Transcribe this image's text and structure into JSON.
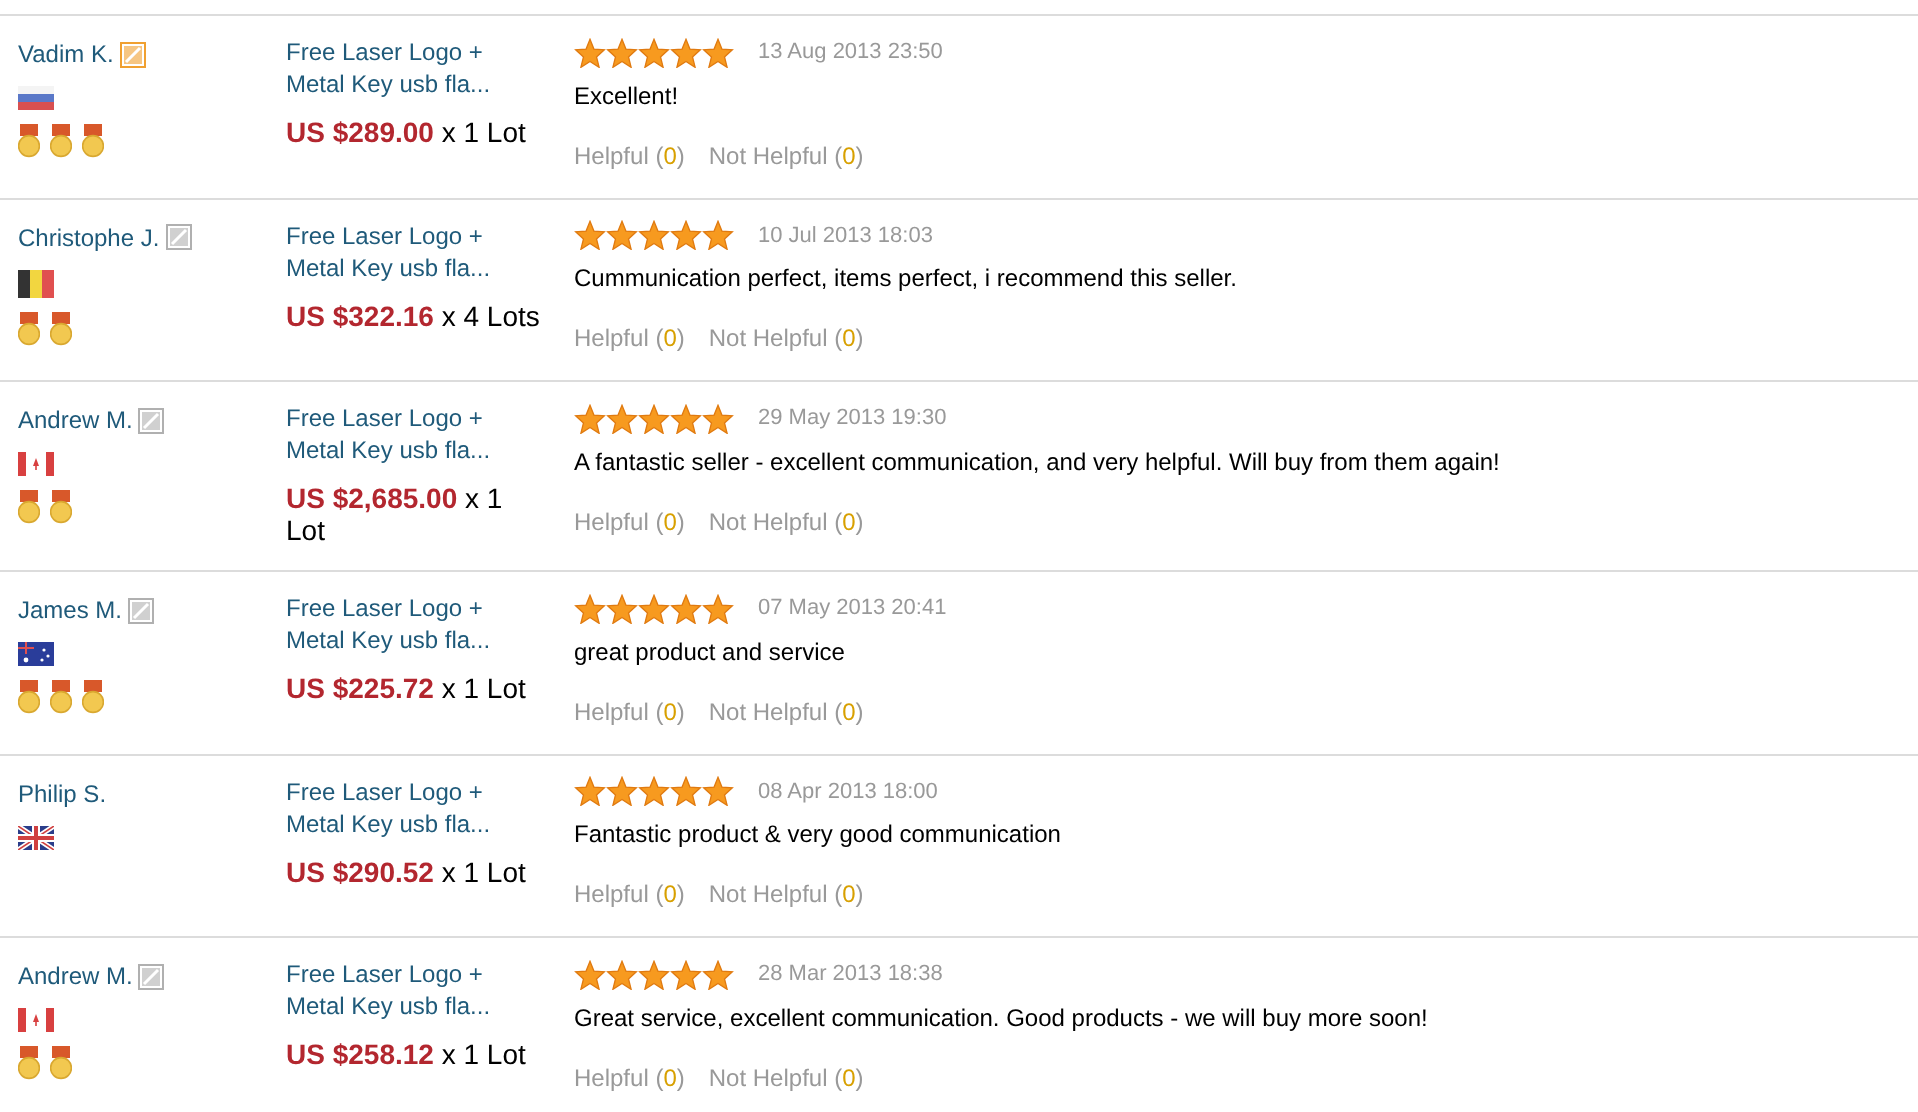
{
  "reviews": [
    {
      "name": "Vadim K.",
      "badge": {
        "color": "#f0a030"
      },
      "flag": {
        "kind": "ru"
      },
      "medals": [
        {
          "kind": "medal"
        },
        {
          "kind": "medal"
        },
        {
          "kind": "medal"
        }
      ],
      "product": "Free Laser Logo + Metal Key usb fla...",
      "price": "US $289.00",
      "quantity": "x 1 Lot",
      "stars": 5,
      "date": "13 Aug 2013 23:50",
      "comment": "Excellent!",
      "helpful": {
        "label": "Helpful (",
        "count": "0",
        "close": ")"
      },
      "not_helpful": {
        "label": "Not Helpful (",
        "count": "0",
        "close": ")"
      }
    },
    {
      "name": "Christophe J.",
      "badge": {
        "color": "#b0b0b0"
      },
      "flag": {
        "kind": "be"
      },
      "medals": [
        {
          "kind": "medal"
        },
        {
          "kind": "medal"
        }
      ],
      "product": "Free Laser Logo + Metal Key usb fla...",
      "price": "US $322.16",
      "quantity": "x 4 Lots",
      "stars": 5,
      "date": "10 Jul 2013 18:03",
      "comment": "Cummunication perfect, items perfect, i recommend this seller.",
      "helpful": {
        "label": "Helpful (",
        "count": "0",
        "close": ")"
      },
      "not_helpful": {
        "label": "Not Helpful (",
        "count": "0",
        "close": ")"
      }
    },
    {
      "name": "Andrew M.",
      "badge": {
        "color": "#b0b0b0"
      },
      "flag": {
        "kind": "ca"
      },
      "medals": [
        {
          "kind": "medal"
        },
        {
          "kind": "medal"
        }
      ],
      "product": "Free Laser Logo + Metal Key usb fla...",
      "price": "US $2,685.00",
      "quantity": "x 1 Lot",
      "stars": 5,
      "date": "29 May 2013 19:30",
      "comment": "A fantastic seller - excellent communication, and very helpful. Will buy from them again!",
      "helpful": {
        "label": "Helpful (",
        "count": "0",
        "close": ")"
      },
      "not_helpful": {
        "label": "Not Helpful (",
        "count": "0",
        "close": ")"
      }
    },
    {
      "name": "James M.",
      "badge": {
        "color": "#b0b0b0"
      },
      "flag": {
        "kind": "au"
      },
      "medals": [
        {
          "kind": "medal"
        },
        {
          "kind": "medal"
        },
        {
          "kind": "medal"
        }
      ],
      "product": "Free Laser Logo + Metal Key usb fla...",
      "price": "US $225.72",
      "quantity": "x 1 Lot",
      "stars": 5,
      "date": "07 May 2013 20:41",
      "comment": "great product and service",
      "helpful": {
        "label": "Helpful (",
        "count": "0",
        "close": ")"
      },
      "not_helpful": {
        "label": "Not Helpful (",
        "count": "0",
        "close": ")"
      }
    },
    {
      "name": "Philip S.",
      "flag": {
        "kind": "gb"
      },
      "product": "Free Laser Logo + Metal Key usb fla...",
      "price": "US $290.52",
      "quantity": "x 1 Lot",
      "stars": 5,
      "date": "08 Apr 2013 18:00",
      "comment": "Fantastic product & very good communication",
      "helpful": {
        "label": "Helpful (",
        "count": "0",
        "close": ")"
      },
      "not_helpful": {
        "label": "Not Helpful (",
        "count": "0",
        "close": ")"
      }
    },
    {
      "name": "Andrew M.",
      "badge": {
        "color": "#b0b0b0"
      },
      "flag": {
        "kind": "ca"
      },
      "medals": [
        {
          "kind": "medal"
        },
        {
          "kind": "medal"
        }
      ],
      "product": "Free Laser Logo + Metal Key usb fla...",
      "price": "US $258.12",
      "quantity": "x 1 Lot",
      "stars": 5,
      "date": "28 Mar 2013 18:38",
      "comment": "Great service, excellent communication. Good products - we will buy more soon!",
      "helpful": {
        "label": "Helpful (",
        "count": "0",
        "close": ")"
      },
      "not_helpful": {
        "label": "Not Helpful (",
        "count": "0",
        "close": ")"
      }
    }
  ]
}
